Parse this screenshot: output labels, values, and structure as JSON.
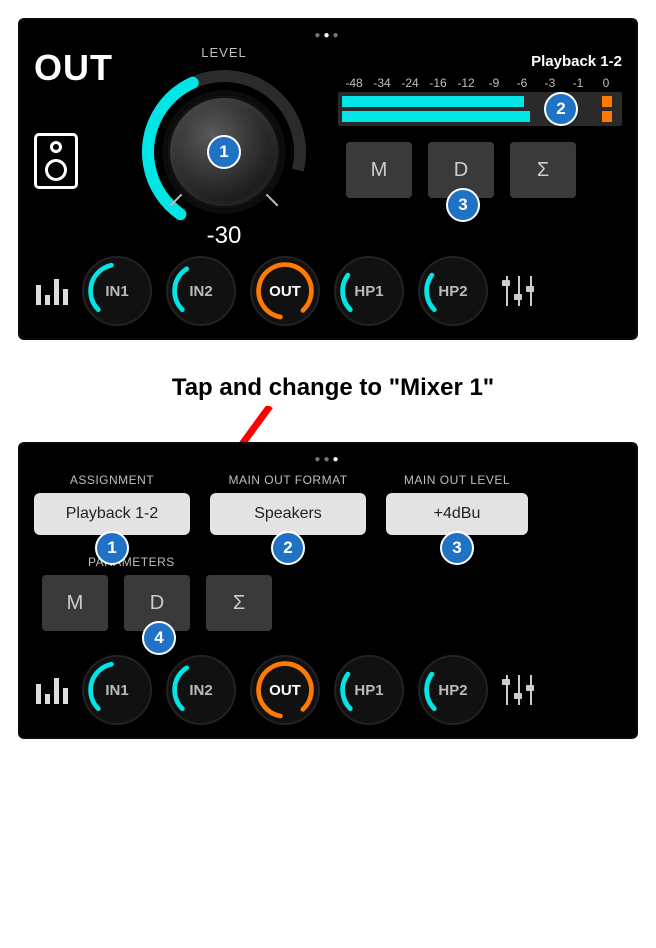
{
  "annotation_text": "Tap and change to \"Mixer 1\"",
  "colors": {
    "accent": "#00e6e6",
    "selected": "#ff7a00",
    "badge": "#1f72c4"
  },
  "panel1": {
    "title": "OUT",
    "level_label": "LEVEL",
    "level_value": "-30",
    "source_label": "Playback 1-2",
    "scale": [
      "-48",
      "-34",
      "-24",
      "-16",
      "-12",
      "-9",
      "-6",
      "-3",
      "-1",
      "0"
    ],
    "meter_ch1_pct": 66,
    "meter_ch2_pct": 68,
    "buttons": {
      "mono": "M",
      "dim": "D",
      "sum": "Σ"
    },
    "badges": {
      "knob": "1",
      "meter": "2",
      "dim": "3"
    },
    "nav": [
      "IN1",
      "IN2",
      "OUT",
      "HP1",
      "HP2"
    ],
    "nav_active": "OUT"
  },
  "panel2": {
    "assignment_label": "ASSIGNMENT",
    "assignment_value": "Playback 1-2",
    "format_label": "MAIN OUT FORMAT",
    "format_value": "Speakers",
    "level_label": "MAIN OUT LEVEL",
    "level_value": "+4dBu",
    "params_label": "PARAMETERS",
    "buttons": {
      "mono": "M",
      "dim": "D",
      "sum": "Σ"
    },
    "badges": {
      "assignment": "1",
      "format": "2",
      "level": "3",
      "dim": "4"
    },
    "nav": [
      "IN1",
      "IN2",
      "OUT",
      "HP1",
      "HP2"
    ],
    "nav_active": "OUT"
  }
}
